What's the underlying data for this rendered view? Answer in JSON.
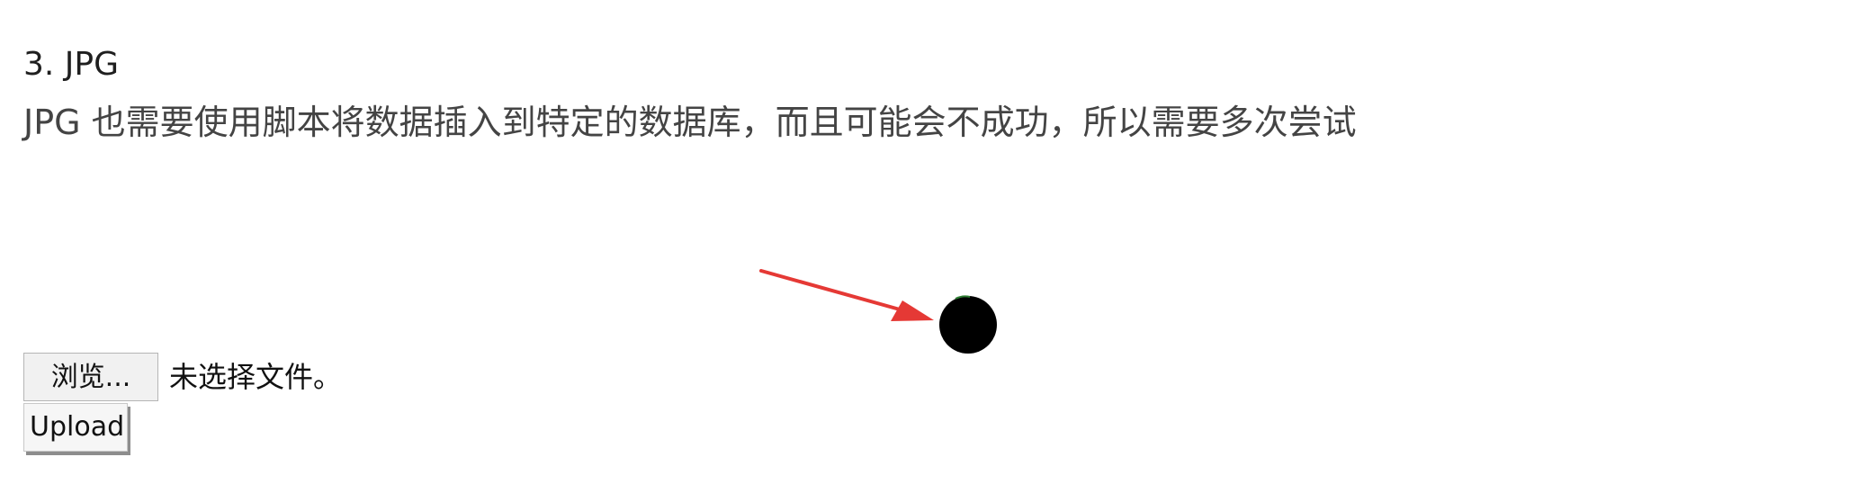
{
  "section": {
    "heading": "3. JPG",
    "description": "JPG 也需要使用脚本将数据插入到特定的数据库，而且可能会不成功，所以需要多次尝试"
  },
  "upload_form": {
    "browse_label": "浏览...",
    "file_status": "未选择文件。",
    "upload_label": "Upload"
  },
  "annotation": {
    "arrow_color": "#e53935",
    "marker_color": "#000000"
  }
}
